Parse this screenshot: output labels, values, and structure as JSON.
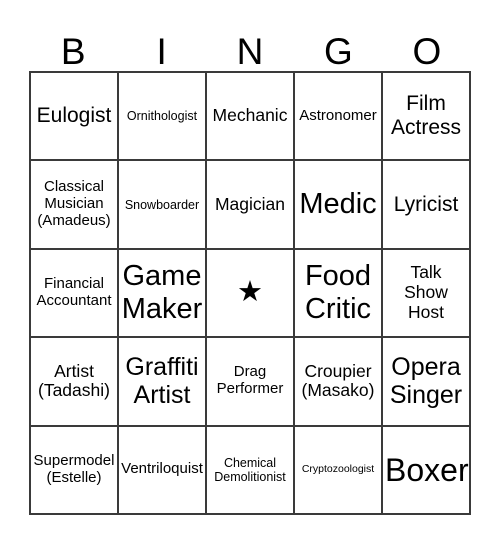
{
  "card": {
    "title": "BINGO",
    "header": {
      "letters": [
        "B",
        "I",
        "N",
        "G",
        "O"
      ]
    },
    "free_space": {
      "icon": "star-icon",
      "glyph": "★",
      "column_index": 2,
      "row_index": 2
    },
    "colors": {
      "background": "#ffffff",
      "grid_line": "#3a3a3a",
      "text": "#000000"
    },
    "grid": {
      "columns": 5,
      "rows": 5,
      "cells": [
        [
          {
            "text": "Eulogist",
            "size": "xl"
          },
          {
            "text": "Ornithologist",
            "size": "s"
          },
          {
            "text": "Mechanic",
            "size": "l"
          },
          {
            "text": "Astronomer",
            "size": "m"
          },
          {
            "text": "Film\nActress",
            "size": "xl"
          }
        ],
        [
          {
            "text": "Classical\nMusician\n(Amadeus)",
            "size": "m"
          },
          {
            "text": "Snowboarder",
            "size": "s"
          },
          {
            "text": "Magician",
            "size": "l"
          },
          {
            "text": "Medic",
            "size": "3xl"
          },
          {
            "text": "Lyricist",
            "size": "xl"
          }
        ],
        [
          {
            "text": "Financial\nAccountant",
            "size": "m"
          },
          {
            "text": "Game\nMaker",
            "size": "3xl"
          },
          {
            "text": "★",
            "size": "free"
          },
          {
            "text": "Food\nCritic",
            "size": "3xl"
          },
          {
            "text": "Talk\nShow\nHost",
            "size": "l"
          }
        ],
        [
          {
            "text": "Artist\n(Tadashi)",
            "size": "l"
          },
          {
            "text": "Graffiti\nArtist",
            "size": "2xl"
          },
          {
            "text": "Drag\nPerformer",
            "size": "m"
          },
          {
            "text": "Croupier\n(Masako)",
            "size": "l"
          },
          {
            "text": "Opera\nSinger",
            "size": "2xl"
          }
        ],
        [
          {
            "text": "Supermodel\n(Estelle)",
            "size": "m"
          },
          {
            "text": "Ventriloquist",
            "size": "m"
          },
          {
            "text": "Chemical\nDemolitionist",
            "size": "s"
          },
          {
            "text": "Cryptozoologist",
            "size": "xs"
          },
          {
            "text": "Boxer",
            "size": "4xl"
          }
        ]
      ]
    }
  }
}
